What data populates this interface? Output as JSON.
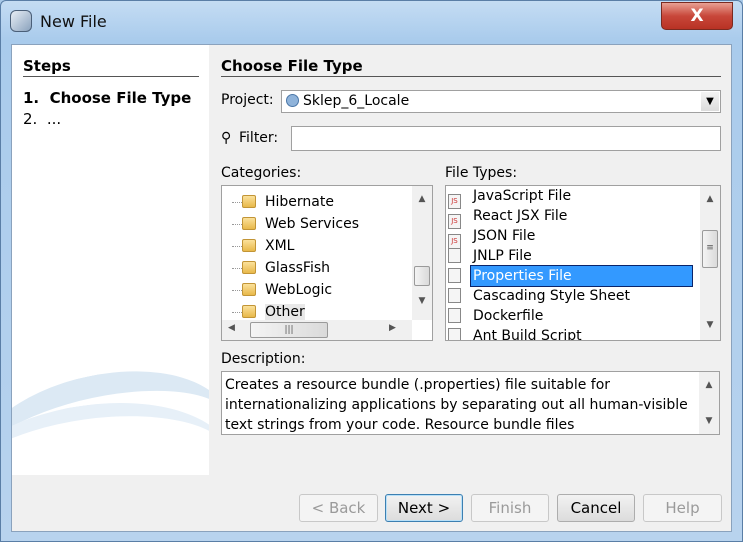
{
  "window": {
    "title": "New File",
    "close_label": "X"
  },
  "steps": {
    "heading": "Steps",
    "items": [
      "1.  Choose File Type",
      "2.  ..."
    ]
  },
  "main": {
    "heading": "Choose File Type",
    "project_label": "Project:",
    "project_value": "Sklep_6_Locale",
    "filter_label": "Filter:",
    "filter_value": "",
    "categories_label": "Categories:",
    "categories": [
      "Hibernate",
      "Web Services",
      "XML",
      "GlassFish",
      "WebLogic",
      "Other"
    ],
    "file_types_label": "File Types:",
    "file_types": [
      {
        "label": "JavaScript File",
        "icon": "js-file-icon"
      },
      {
        "label": "React JSX File",
        "icon": "js-file-icon"
      },
      {
        "label": "JSON File",
        "icon": "js-file-icon"
      },
      {
        "label": "JNLP File",
        "icon": "jnlp-icon"
      },
      {
        "label": "Properties File",
        "icon": "properties-file-icon",
        "selected": true
      },
      {
        "label": "Cascading Style Sheet",
        "icon": "css-icon"
      },
      {
        "label": "Dockerfile",
        "icon": "docker-icon"
      },
      {
        "label": "Ant Build Script",
        "icon": "ant-icon"
      }
    ],
    "description_label": "Description:",
    "description": "Creates a resource bundle (.properties) file suitable for internationalizing applications by separating out all human-visible text strings from your code. Resource bundle files"
  },
  "buttons": {
    "back": "< Back",
    "next": "Next >",
    "finish": "Finish",
    "cancel": "Cancel",
    "help": "Help"
  },
  "colors": {
    "selection": "#3399ff",
    "close_button": "#c8473a"
  }
}
